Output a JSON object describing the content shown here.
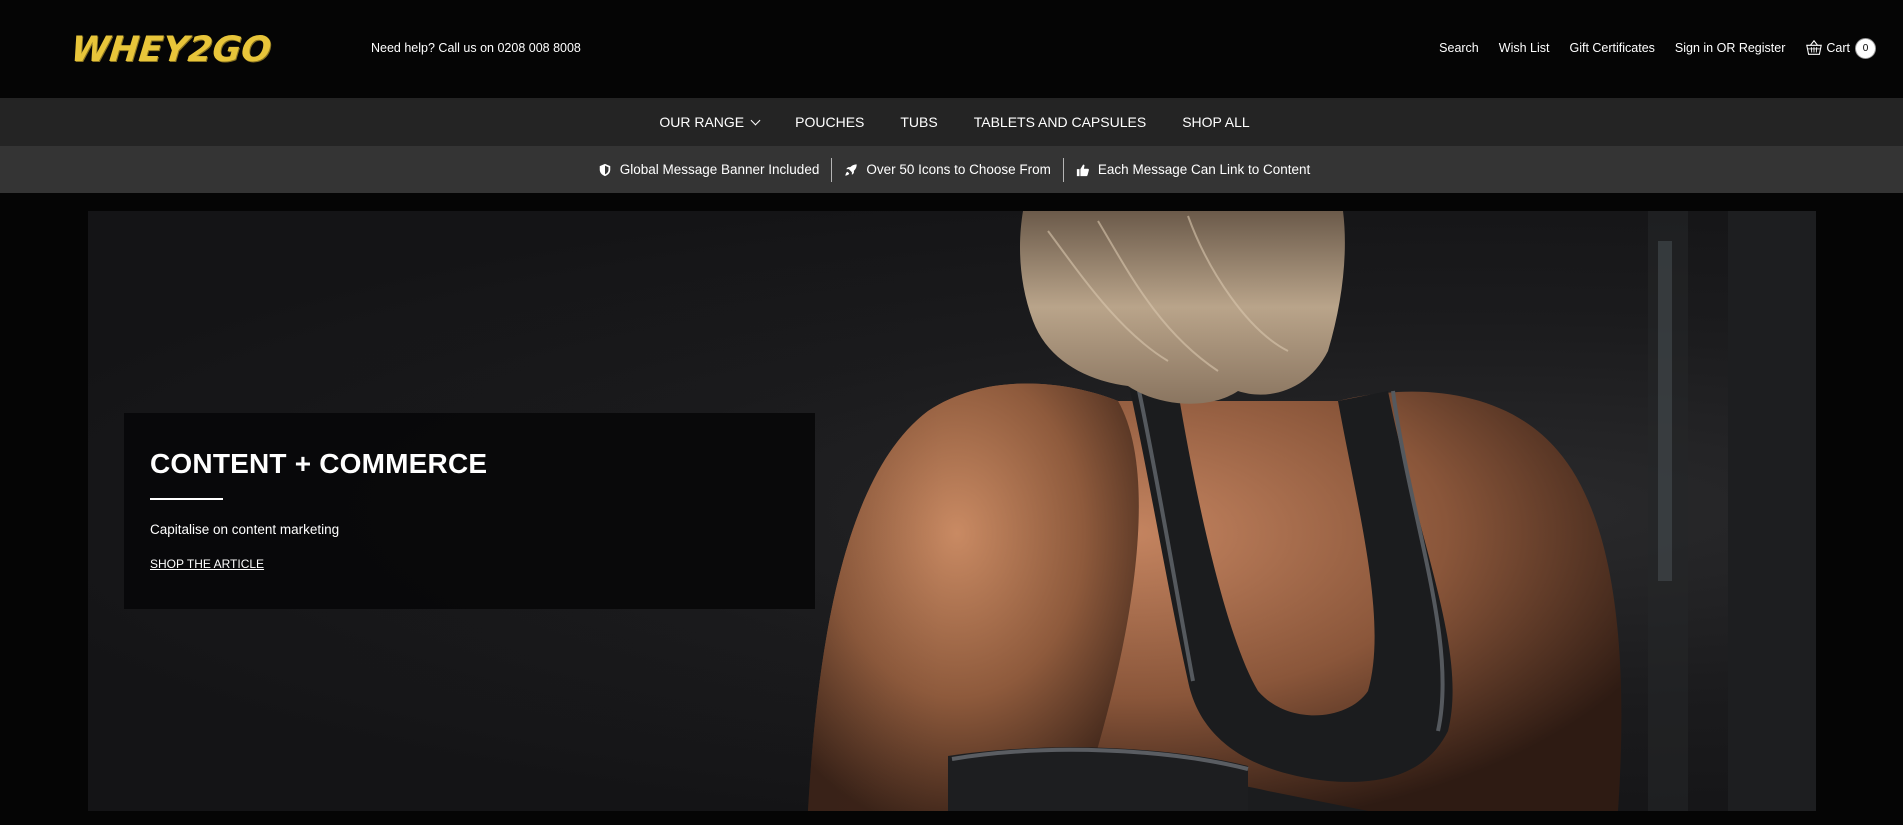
{
  "header": {
    "logo_text": "WHEY2GO",
    "logo_color": "#e8c53a",
    "helpline": "Need help? Call us on 0208 008 8008",
    "links": {
      "search": "Search",
      "wishlist": "Wish List",
      "gift": "Gift Certificates",
      "signin": "Sign in OR Register",
      "cart": "Cart",
      "cart_count": "0"
    },
    "cart_icon": "basket-icon"
  },
  "nav": {
    "items": [
      "OUR RANGE",
      "POUCHES",
      "TUBS",
      "TABLETS AND CAPSULES",
      "SHOP ALL"
    ],
    "dropdown_icon": "chevron-down-icon"
  },
  "banner": {
    "messages": [
      {
        "icon": "shield-icon",
        "text": "Global Message Banner Included"
      },
      {
        "icon": "rocket-icon",
        "text": "Over 50 Icons to Choose From"
      },
      {
        "icon": "thumbs-up-icon",
        "text": "Each Message Can Link to Content"
      }
    ]
  },
  "hero": {
    "title": "CONTENT + COMMERCE",
    "subtitle": "Capitalise on content marketing",
    "cta": "SHOP THE ARTICLE"
  },
  "colors": {
    "page_bg": "#050505",
    "nav_bg": "#242424",
    "banner_bg": "#343434",
    "accent": "#e8c53a"
  }
}
